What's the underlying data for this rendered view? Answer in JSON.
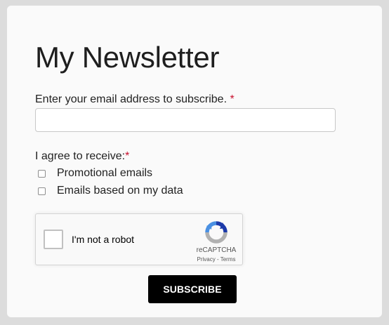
{
  "form": {
    "title": "My Newsletter",
    "email_label": "Enter your email address to subscribe.",
    "required_marker": "*",
    "email_value": "",
    "email_placeholder": "",
    "agree_label": "I agree to receive:",
    "options": [
      {
        "label": "Promotional emails",
        "checked": false
      },
      {
        "label": "Emails based on my data",
        "checked": false
      }
    ],
    "subscribe_label": "SUBSCRIBE"
  },
  "recaptcha": {
    "label": "I'm not a robot",
    "brand": "reCAPTCHA",
    "privacy_label": "Privacy",
    "separator": " - ",
    "terms_label": "Terms"
  },
  "colors": {
    "required": "#c8102e",
    "button_bg": "#000000",
    "button_text": "#ffffff",
    "recaptcha_blue": "#1c3aa9",
    "recaptcha_light_blue": "#4a90e2",
    "recaptcha_gray": "#b1b1b1"
  },
  "icons": {
    "recaptcha_logo": "recaptcha-logo-icon"
  }
}
